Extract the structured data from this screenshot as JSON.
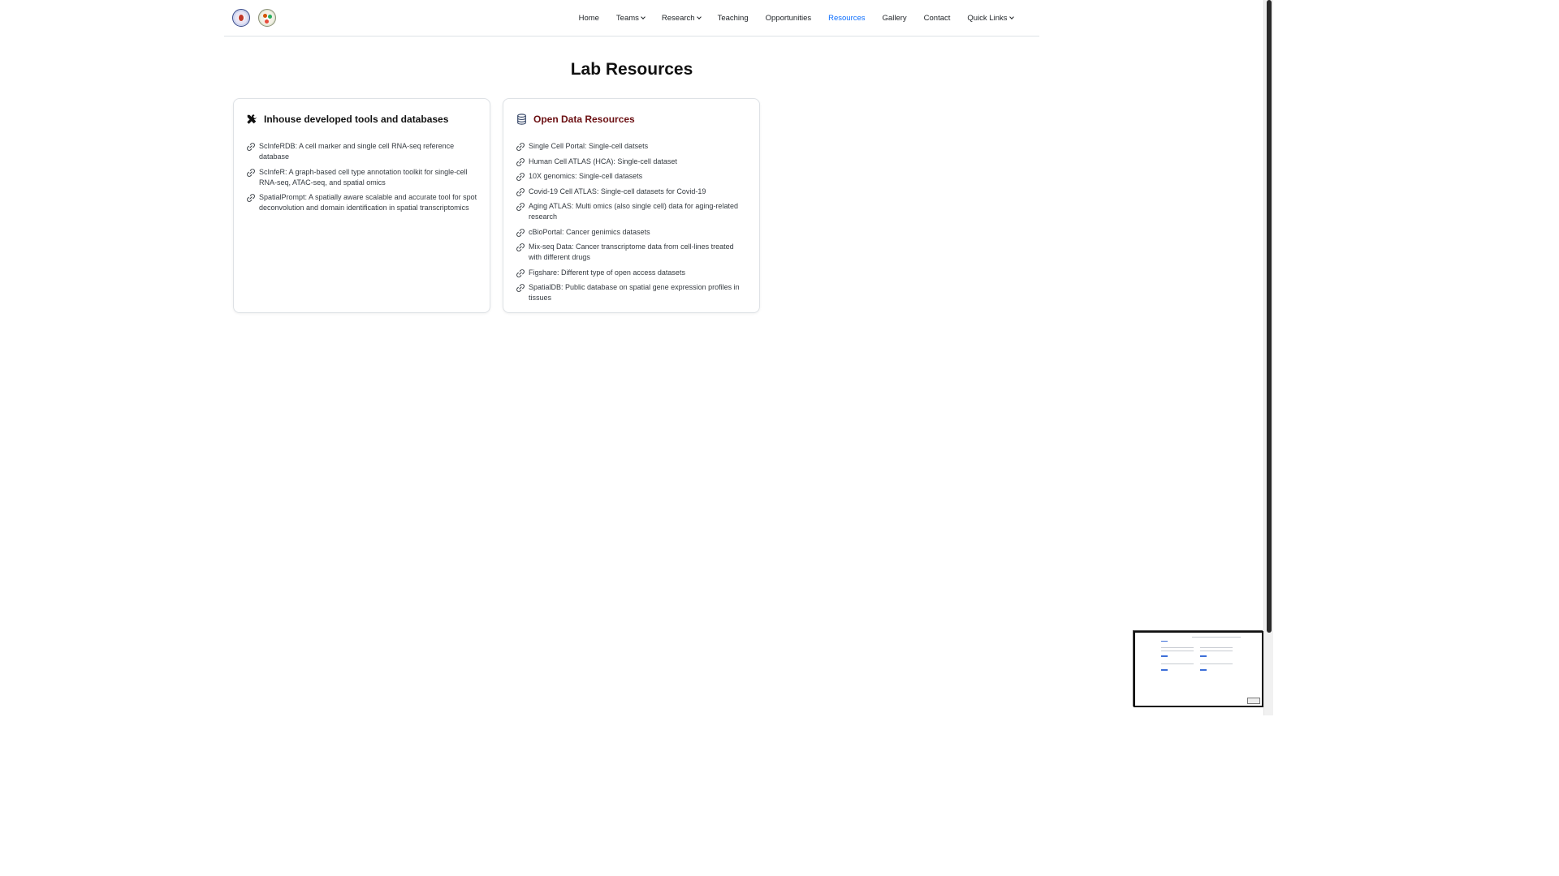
{
  "nav": {
    "items": [
      {
        "label": "Home"
      },
      {
        "label": "Teams",
        "dropdown": true
      },
      {
        "label": "Research",
        "dropdown": true
      },
      {
        "label": "Teaching"
      },
      {
        "label": "Opportunities"
      },
      {
        "label": "Resources",
        "active": true
      },
      {
        "label": "Gallery"
      },
      {
        "label": "Contact"
      },
      {
        "label": "Quick Links",
        "dropdown": true
      }
    ],
    "active_color": "#0d6efd"
  },
  "page": {
    "title": "Lab Resources"
  },
  "cards": [
    {
      "title": "Inhouse developed tools and databases",
      "icon": "tools-icon",
      "items": [
        {
          "text": "ScInfeRDB: A cell marker and single cell RNA-seq reference database"
        },
        {
          "text": "ScInfeR: A graph-based cell type annotation toolkit for single-cell RNA-seq, ATAC-seq, and spatial omics"
        },
        {
          "text": "SpatialPrompt: A spatially aware scalable and accurate tool for spot deconvolution and domain identification in spatial transcriptomics"
        }
      ]
    },
    {
      "title": "Open Data Resources",
      "icon": "database-icon",
      "title_color": "#6b0f12",
      "items": [
        {
          "text": "Single Cell Portal: Single-cell datsets"
        },
        {
          "text": "Human Cell ATLAS (HCA): Single-cell dataset"
        },
        {
          "text": "10X genomics: Single-cell datasets"
        },
        {
          "text": "Covid-19 Cell ATLAS: Single-cell datasets for Covid-19"
        },
        {
          "text": "Aging ATLAS: Multi omics (also single cell) data for aging-related research"
        },
        {
          "text": "cBioPortal: Cancer genimics datasets"
        },
        {
          "text": "Mix-seq Data: Cancer transcriptome data from cell-lines treated with different drugs"
        },
        {
          "text": "Figshare: Different type of open access datasets"
        },
        {
          "text": "SpatialDB: Public database on spatial gene expression profiles in tissues"
        }
      ]
    }
  ]
}
